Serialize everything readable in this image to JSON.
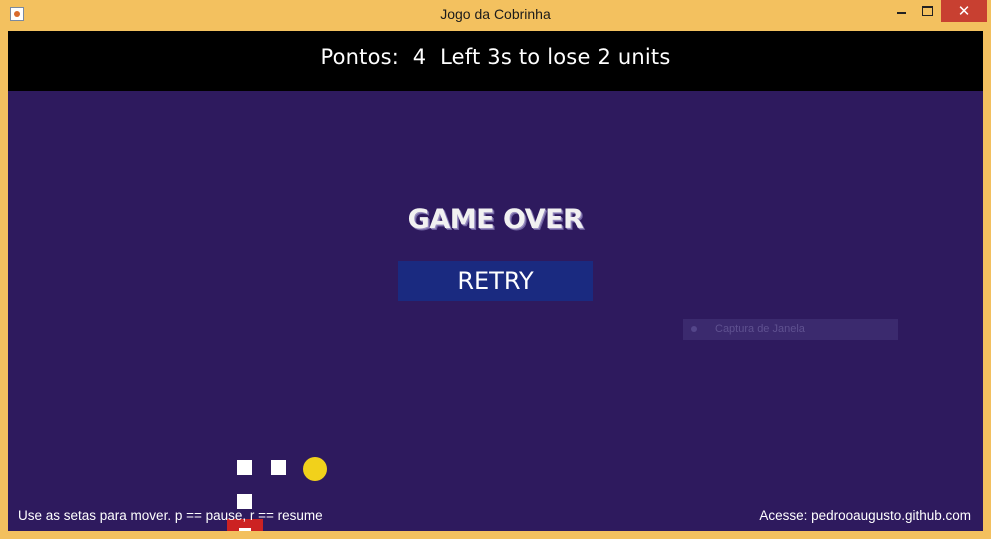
{
  "window": {
    "title": "Jogo da Cobrinha",
    "close_symbol": "✕",
    "icon": "java-app-icon",
    "frame_color": "#f3c15f"
  },
  "hud": {
    "score_text": "Pontos:  4  Left 3s to lose 2 units"
  },
  "overlay": {
    "game_over": "GAME OVER",
    "retry_label": "RETRY",
    "capture_hint": "Captura de Janela"
  },
  "footer": {
    "instructions": "Use as setas para mover. p == pause, r == resume",
    "link": "Acesse: pedrooaugusto.github.com"
  },
  "colors": {
    "board_background": "#2e1a5e",
    "hud_background": "#000000",
    "retry_background": "#1a2a80",
    "food": "#f1d11b",
    "snake_segment": "#ffffff",
    "obstacle": "#cc2222"
  },
  "board": {
    "snake_segments": 3,
    "food": 1
  }
}
